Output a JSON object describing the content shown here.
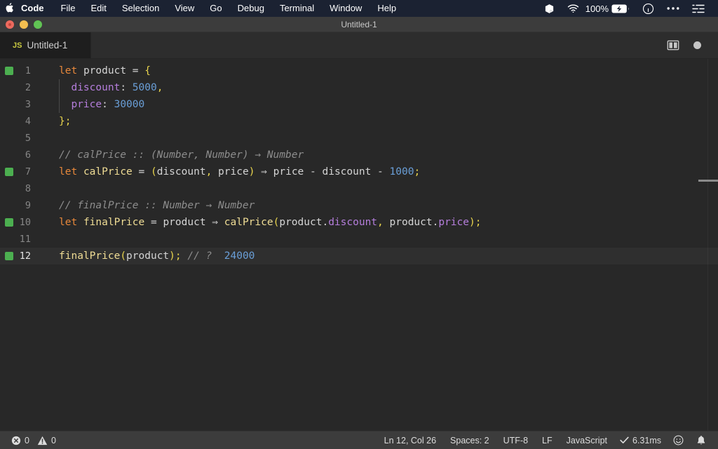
{
  "menubar": {
    "apple_icon": "apple-logo-icon",
    "items": [
      {
        "label": "Code",
        "bold": true
      },
      {
        "label": "File",
        "bold": false
      },
      {
        "label": "Edit",
        "bold": false
      },
      {
        "label": "Selection",
        "bold": false
      },
      {
        "label": "View",
        "bold": false
      },
      {
        "label": "Go",
        "bold": false
      },
      {
        "label": "Debug",
        "bold": false
      },
      {
        "label": "Terminal",
        "bold": false
      },
      {
        "label": "Window",
        "bold": false
      },
      {
        "label": "Help",
        "bold": false
      }
    ],
    "status": {
      "box_icon": "box-icon",
      "wifi_icon": "wifi-icon",
      "battery_percent": "100%",
      "battery_icon": "battery-charging-icon",
      "siri_icon": "siri-icon",
      "more_icon": "ellipsis-icon",
      "control_center_icon": "control-center-icon"
    }
  },
  "window": {
    "title": "Untitled-1",
    "traffic_lights": [
      "close",
      "minimize",
      "zoom"
    ]
  },
  "tabbar": {
    "tabs": [
      {
        "icon_label": "JS",
        "label": "Untitled-1",
        "active": true
      }
    ],
    "split_editor_icon": "split-editor-icon",
    "unsaved_icon": "unsaved-dot-icon"
  },
  "editor": {
    "language": "JavaScript",
    "lines": [
      {
        "num": "1",
        "marker": true,
        "active": false,
        "indent_guide": false,
        "tokens": [
          {
            "t": "let",
            "c": "t-kw"
          },
          {
            "t": " ",
            "c": "t-punc"
          },
          {
            "t": "product",
            "c": "t-var"
          },
          {
            "t": " ",
            "c": "t-punc"
          },
          {
            "t": "=",
            "c": "t-op"
          },
          {
            "t": " ",
            "c": "t-punc"
          },
          {
            "t": "{",
            "c": "t-brace"
          }
        ]
      },
      {
        "num": "2",
        "marker": false,
        "active": false,
        "indent_guide": true,
        "tokens": [
          {
            "t": "  ",
            "c": "t-punc"
          },
          {
            "t": "discount",
            "c": "t-prop"
          },
          {
            "t": ": ",
            "c": "t-punc"
          },
          {
            "t": "5000",
            "c": "t-num"
          },
          {
            "t": ",",
            "c": "t-brace"
          }
        ]
      },
      {
        "num": "3",
        "marker": false,
        "active": false,
        "indent_guide": true,
        "tokens": [
          {
            "t": "  ",
            "c": "t-punc"
          },
          {
            "t": "price",
            "c": "t-prop"
          },
          {
            "t": ": ",
            "c": "t-punc"
          },
          {
            "t": "30000",
            "c": "t-num"
          }
        ]
      },
      {
        "num": "4",
        "marker": false,
        "active": false,
        "indent_guide": false,
        "tokens": [
          {
            "t": "}",
            "c": "t-brace"
          },
          {
            "t": ";",
            "c": "t-brace"
          }
        ]
      },
      {
        "num": "5",
        "marker": false,
        "active": false,
        "indent_guide": false,
        "tokens": []
      },
      {
        "num": "6",
        "marker": false,
        "active": false,
        "indent_guide": false,
        "tokens": [
          {
            "t": "// calPrice :: (Number, Number) → Number",
            "c": "t-cmt"
          }
        ]
      },
      {
        "num": "7",
        "marker": true,
        "active": false,
        "indent_guide": false,
        "tokens": [
          {
            "t": "let",
            "c": "t-kw"
          },
          {
            "t": " ",
            "c": "t-punc"
          },
          {
            "t": "calPrice",
            "c": "t-fn"
          },
          {
            "t": " ",
            "c": "t-punc"
          },
          {
            "t": "=",
            "c": "t-op"
          },
          {
            "t": " ",
            "c": "t-punc"
          },
          {
            "t": "(",
            "c": "t-brace"
          },
          {
            "t": "discount",
            "c": "t-var"
          },
          {
            "t": ",",
            "c": "t-brace"
          },
          {
            "t": " ",
            "c": "t-punc"
          },
          {
            "t": "price",
            "c": "t-var"
          },
          {
            "t": ")",
            "c": "t-brace"
          },
          {
            "t": " ",
            "c": "t-punc"
          },
          {
            "t": "⇒",
            "c": "t-op"
          },
          {
            "t": " ",
            "c": "t-punc"
          },
          {
            "t": "price",
            "c": "t-var"
          },
          {
            "t": " - ",
            "c": "t-op"
          },
          {
            "t": "discount",
            "c": "t-var"
          },
          {
            "t": " - ",
            "c": "t-op"
          },
          {
            "t": "1000",
            "c": "t-num"
          },
          {
            "t": ";",
            "c": "t-brace"
          }
        ]
      },
      {
        "num": "8",
        "marker": false,
        "active": false,
        "indent_guide": false,
        "tokens": []
      },
      {
        "num": "9",
        "marker": false,
        "active": false,
        "indent_guide": false,
        "tokens": [
          {
            "t": "// finalPrice :: Number → Number",
            "c": "t-cmt"
          }
        ]
      },
      {
        "num": "10",
        "marker": true,
        "active": false,
        "indent_guide": false,
        "tokens": [
          {
            "t": "let",
            "c": "t-kw"
          },
          {
            "t": " ",
            "c": "t-punc"
          },
          {
            "t": "finalPrice",
            "c": "t-fn"
          },
          {
            "t": " ",
            "c": "t-punc"
          },
          {
            "t": "=",
            "c": "t-op"
          },
          {
            "t": " ",
            "c": "t-punc"
          },
          {
            "t": "product",
            "c": "t-var"
          },
          {
            "t": " ",
            "c": "t-punc"
          },
          {
            "t": "⇒",
            "c": "t-op"
          },
          {
            "t": " ",
            "c": "t-punc"
          },
          {
            "t": "calPrice",
            "c": "t-fn"
          },
          {
            "t": "(",
            "c": "t-brace"
          },
          {
            "t": "product",
            "c": "t-var"
          },
          {
            "t": ".",
            "c": "t-punc"
          },
          {
            "t": "discount",
            "c": "t-prop"
          },
          {
            "t": ",",
            "c": "t-brace"
          },
          {
            "t": " ",
            "c": "t-punc"
          },
          {
            "t": "product",
            "c": "t-var"
          },
          {
            "t": ".",
            "c": "t-punc"
          },
          {
            "t": "price",
            "c": "t-prop"
          },
          {
            "t": ")",
            "c": "t-brace"
          },
          {
            "t": ";",
            "c": "t-brace"
          }
        ]
      },
      {
        "num": "11",
        "marker": false,
        "active": false,
        "indent_guide": false,
        "tokens": []
      },
      {
        "num": "12",
        "marker": true,
        "active": true,
        "indent_guide": false,
        "tokens": [
          {
            "t": "finalPrice",
            "c": "t-fn"
          },
          {
            "t": "(",
            "c": "t-brace"
          },
          {
            "t": "product",
            "c": "t-var"
          },
          {
            "t": ")",
            "c": "t-brace"
          },
          {
            "t": ";",
            "c": "t-brace"
          },
          {
            "t": " ",
            "c": "t-punc"
          },
          {
            "t": "// ?",
            "c": "t-cmt"
          },
          {
            "t": "  ",
            "c": "t-punc"
          },
          {
            "t": "24000",
            "c": "t-hint"
          }
        ]
      }
    ]
  },
  "statusbar": {
    "errors_icon": "error-icon",
    "errors_count": "0",
    "warnings_icon": "warning-icon",
    "warnings_count": "0",
    "cursor_position": "Ln 12, Col 26",
    "indentation": "Spaces: 2",
    "encoding": "UTF-8",
    "eol": "LF",
    "language_mode": "JavaScript",
    "run_time": "6.31ms",
    "run_icon": "check-icon",
    "feedback_icon": "smiley-icon",
    "notifications_icon": "bell-icon"
  },
  "colors": {
    "menubar_bg": "#1b2232",
    "titlebar_bg": "#3c3c3c",
    "tabbar_bg": "#2d2d2d",
    "tab_active_bg": "#1e1e1e",
    "editor_bg": "#282828",
    "active_line_bg": "#2f2f2f",
    "statusbar_bg": "#3c3c3c",
    "gutter_marker": "#4caf50",
    "keyword": "#e8883b",
    "function": "#f0dd95",
    "property": "#b57edc",
    "number": "#6a9fd8",
    "brace": "#e8d44d",
    "comment": "#8d8d8d",
    "js_icon": "#cbcb41"
  }
}
